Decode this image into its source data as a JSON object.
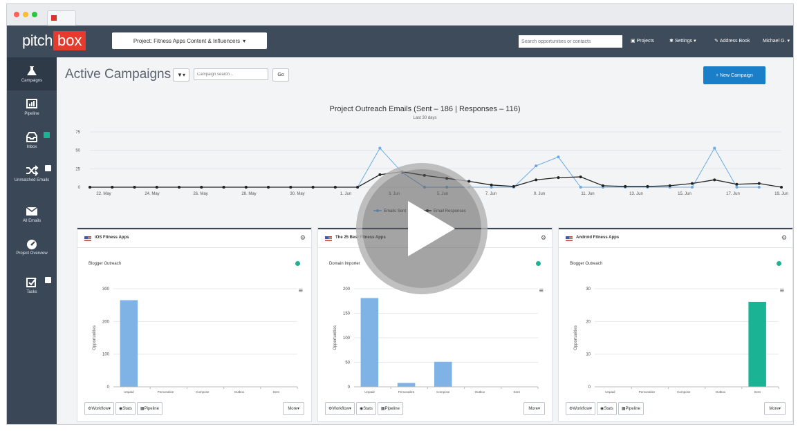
{
  "browser": {
    "dots": [
      "#ff5f57",
      "#febc2e",
      "#28c840"
    ]
  },
  "logo": {
    "part1": "pitch",
    "part2": "box"
  },
  "topnav": {
    "project_label": "Project: Fitness Apps Content & Influencers",
    "search_placeholder": "Search opportunities or contacts",
    "projects": "Projects",
    "settings": "Settings",
    "address_book": "Address Book",
    "user": "Michael G."
  },
  "sidebar": {
    "items": [
      {
        "label": "Campaigns",
        "icon": "flask-icon"
      },
      {
        "label": "Pipeline",
        "icon": "pipeline-chart-icon"
      },
      {
        "label": "Inbox",
        "icon": "inbox-icon"
      },
      {
        "label": "Unmatched Emails",
        "icon": "shuffle-icon"
      },
      {
        "label": "All Emails",
        "icon": "envelope-icon"
      },
      {
        "label": "Project Overview",
        "icon": "dashboard-icon"
      },
      {
        "label": "Tasks",
        "icon": "checkbox-icon"
      }
    ]
  },
  "header": {
    "title": "Active Campaigns",
    "search_placeholder": "Campaign search...",
    "go": "Go",
    "new_campaign": "+ New Campaign"
  },
  "colors": {
    "accent": "#1a7ec8",
    "sent": "#6aaae4",
    "responses": "#222222",
    "bar_blue": "#7fb3e6",
    "bar_green": "#1ab394",
    "brand": "#e53b2c"
  },
  "chart_data": [
    {
      "type": "line",
      "title": "Project Outreach Emails (Sent – 186 | Responses – 116)",
      "subtitle": "Last 30 days",
      "ylim": [
        0,
        75
      ],
      "yticks": [
        0,
        25,
        50,
        75
      ],
      "x_tick_labels": [
        "22. May",
        "24. May",
        "26. May",
        "28. May",
        "30. May",
        "1. Jun",
        "3. Jun",
        "5. Jun",
        "7. Jun",
        "9. Jun",
        "11. Jun",
        "13. Jun",
        "15. Jun",
        "17. Jun",
        "19. Jun"
      ],
      "x": [
        "21. May",
        "22. May",
        "23. May",
        "24. May",
        "25. May",
        "26. May",
        "27. May",
        "28. May",
        "29. May",
        "30. May",
        "31. May",
        "1. Jun",
        "2. Jun",
        "3. Jun",
        "4. Jun",
        "5. Jun",
        "6. Jun",
        "7. Jun",
        "8. Jun",
        "9. Jun",
        "10. Jun",
        "11. Jun",
        "12. Jun",
        "13. Jun",
        "14. Jun",
        "15. Jun",
        "16. Jun",
        "17. Jun",
        "18. Jun",
        "19. Jun"
      ],
      "series": [
        {
          "name": "Emails Sent",
          "values": [
            0,
            0,
            0,
            0,
            0,
            0,
            0,
            0,
            0,
            0,
            0,
            0,
            0,
            53,
            20,
            0,
            0,
            0,
            0,
            0,
            29,
            41,
            0,
            0,
            0,
            0,
            0,
            0,
            53,
            0,
            0
          ]
        },
        {
          "name": "Email Responses",
          "values": [
            0,
            0,
            0,
            0,
            0,
            0,
            0,
            0,
            0,
            0,
            0,
            0,
            0,
            17,
            21,
            16,
            12,
            8,
            3,
            1,
            10,
            13,
            14,
            2,
            1,
            1,
            2,
            5,
            10,
            4,
            5,
            0
          ]
        }
      ],
      "legend": "bottom",
      "grid": true
    },
    {
      "type": "bar",
      "categories": [
        "Unpaid",
        "Personalize",
        "Compose",
        "Outbox",
        "Sent"
      ],
      "values": [
        265,
        0,
        0,
        0,
        0
      ],
      "ylabel": "Opportunities",
      "yticks": [
        0,
        100,
        200,
        300
      ],
      "ylim": [
        0,
        300
      ],
      "color": "#7fb3e6"
    },
    {
      "type": "bar",
      "categories": [
        "Unpaid",
        "Personalize",
        "Compose",
        "Outbox",
        "Sent"
      ],
      "values": [
        181,
        8,
        51,
        0,
        0
      ],
      "ylabel": "Opportunities",
      "yticks": [
        0,
        50,
        100,
        150,
        200
      ],
      "ylim": [
        0,
        200
      ],
      "color": "#7fb3e6"
    },
    {
      "type": "bar",
      "categories": [
        "Unpaid",
        "Personalize",
        "Compose",
        "Outbox",
        "Sent"
      ],
      "values": [
        0,
        0,
        0,
        0,
        26
      ],
      "ylabel": "Opportunities",
      "yticks": [
        0,
        10,
        20,
        30
      ],
      "ylim": [
        0,
        30
      ],
      "color": "#1ab394"
    }
  ],
  "panels": [
    {
      "title": "iOS Fitness Apps",
      "subtitle": "Blogger Outreach"
    },
    {
      "title": "The 25 Best Fitness Apps",
      "subtitle": "Domain Importer"
    },
    {
      "title": "Android Fitness Apps",
      "subtitle": "Blogger Outreach"
    }
  ],
  "panel_buttons": {
    "workflow": "Workflow",
    "stats": "Stats",
    "pipeline": "Pipeline",
    "more": "More"
  }
}
